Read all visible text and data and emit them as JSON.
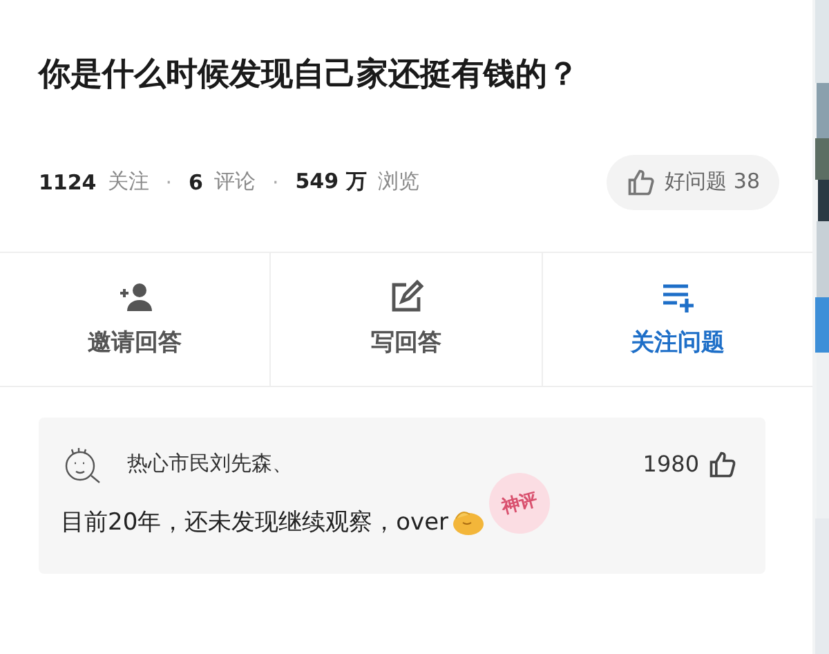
{
  "question": {
    "title": "你是什么时候发现自己家还挺有钱的？"
  },
  "stats": [
    {
      "number": "1124",
      "label": "关注"
    },
    {
      "number": "6",
      "label": "评论"
    },
    {
      "number": "549 万",
      "label": "浏览"
    }
  ],
  "separator": "·",
  "good_question": {
    "label": "好问题 38"
  },
  "actions": [
    {
      "kind": "invite",
      "label": "邀请回答",
      "selected": false
    },
    {
      "kind": "write",
      "label": "写回答",
      "selected": false
    },
    {
      "kind": "follow",
      "label": "关注问题",
      "selected": true
    }
  ],
  "comment": {
    "author": "热心市民刘先森、",
    "likes": "1980",
    "text": "目前20年，还未发现继续观察，over",
    "stamp": "神评"
  }
}
